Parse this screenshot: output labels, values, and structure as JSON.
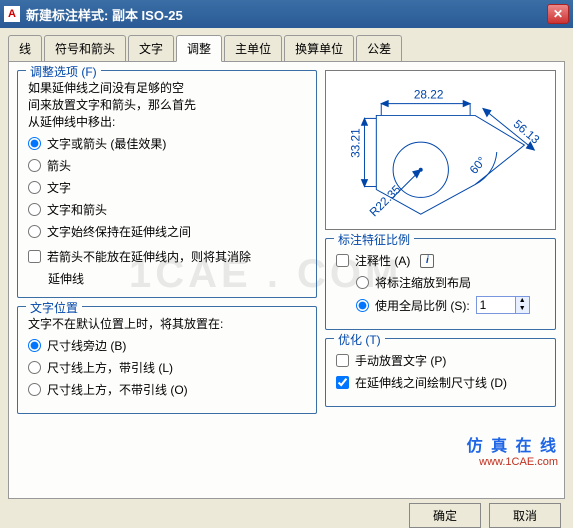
{
  "window": {
    "title": "新建标注样式: 副本 ISO-25"
  },
  "tabs": [
    "线",
    "符号和箭头",
    "文字",
    "调整",
    "主单位",
    "换算单位",
    "公差"
  ],
  "active_tab": "调整",
  "fit_options": {
    "title": "调整选项 (F)",
    "intro1": "如果延伸线之间没有足够的空",
    "intro2": "间来放置文字和箭头，那么首先",
    "intro3": "从延伸线中移出:",
    "r1": "文字或箭头 (最佳效果)",
    "r2": "箭头",
    "r3": "文字",
    "r4": "文字和箭头",
    "r5": "文字始终保持在延伸线之间",
    "c1a": "若箭头不能放在延伸线内，则将其消除",
    "c1b": "延伸线"
  },
  "text_pos": {
    "title": "文字位置",
    "intro": "文字不在默认位置上时，将其放置在:",
    "r1": "尺寸线旁边 (B)",
    "r2": "尺寸线上方，带引线 (L)",
    "r3": "尺寸线上方，不带引线 (O)"
  },
  "scale": {
    "title": "标注特征比例",
    "c_anno": "注释性 (A)",
    "r_layout": "将标注缩放到布局",
    "r_global": "使用全局比例 (S):",
    "value": "1"
  },
  "tune": {
    "title": "优化 (T)",
    "c1": "手动放置文字 (P)",
    "c2": "在延伸线之间绘制尺寸线 (D)"
  },
  "preview": {
    "d_top": "28.22",
    "d_left": "33.21",
    "d_diag": "56.13",
    "d_ang": "60°",
    "d_rad": "R22.35"
  },
  "buttons": {
    "ok": "确定",
    "cancel": "取消"
  },
  "watermark": {
    "cn": "仿 真 在 线",
    "en": "www.1CAE.com",
    "big": "1CAE  .  COM"
  }
}
